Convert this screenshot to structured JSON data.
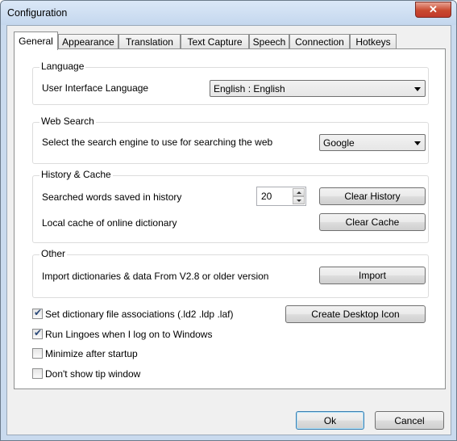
{
  "window": {
    "title": "Configuration",
    "close_glyph": "✕"
  },
  "tabs": [
    "General",
    "Appearance",
    "Translation",
    "Text Capture",
    "Speech",
    "Connection",
    "Hotkeys"
  ],
  "language": {
    "group_title": "Language",
    "label": "User Interface Language",
    "value": "English  :  English"
  },
  "web_search": {
    "group_title": "Web Search",
    "label": "Select the search engine to use for searching the web",
    "value": "Google"
  },
  "history": {
    "group_title": "History & Cache",
    "saved_label": "Searched words saved in history",
    "saved_value": "20",
    "clear_history": "Clear History",
    "cache_label": "Local cache of online dictionary",
    "clear_cache": "Clear Cache"
  },
  "other": {
    "group_title": "Other",
    "import_label": "Import dictionaries & data From V2.8 or older version",
    "import_button": "Import"
  },
  "options": {
    "associations": {
      "label": "Set dictionary file associations (.ld2 .ldp .laf)",
      "checked": true
    },
    "run_on_logon": {
      "label": "Run Lingoes when I log on to Windows",
      "checked": true
    },
    "minimize": {
      "label": "Minimize after startup",
      "checked": false
    },
    "no_tip": {
      "label": "Don't show tip window",
      "checked": false
    },
    "create_icon": "Create Desktop Icon",
    "check_glyph": "✔"
  },
  "footer": {
    "ok": "Ok",
    "cancel": "Cancel"
  }
}
